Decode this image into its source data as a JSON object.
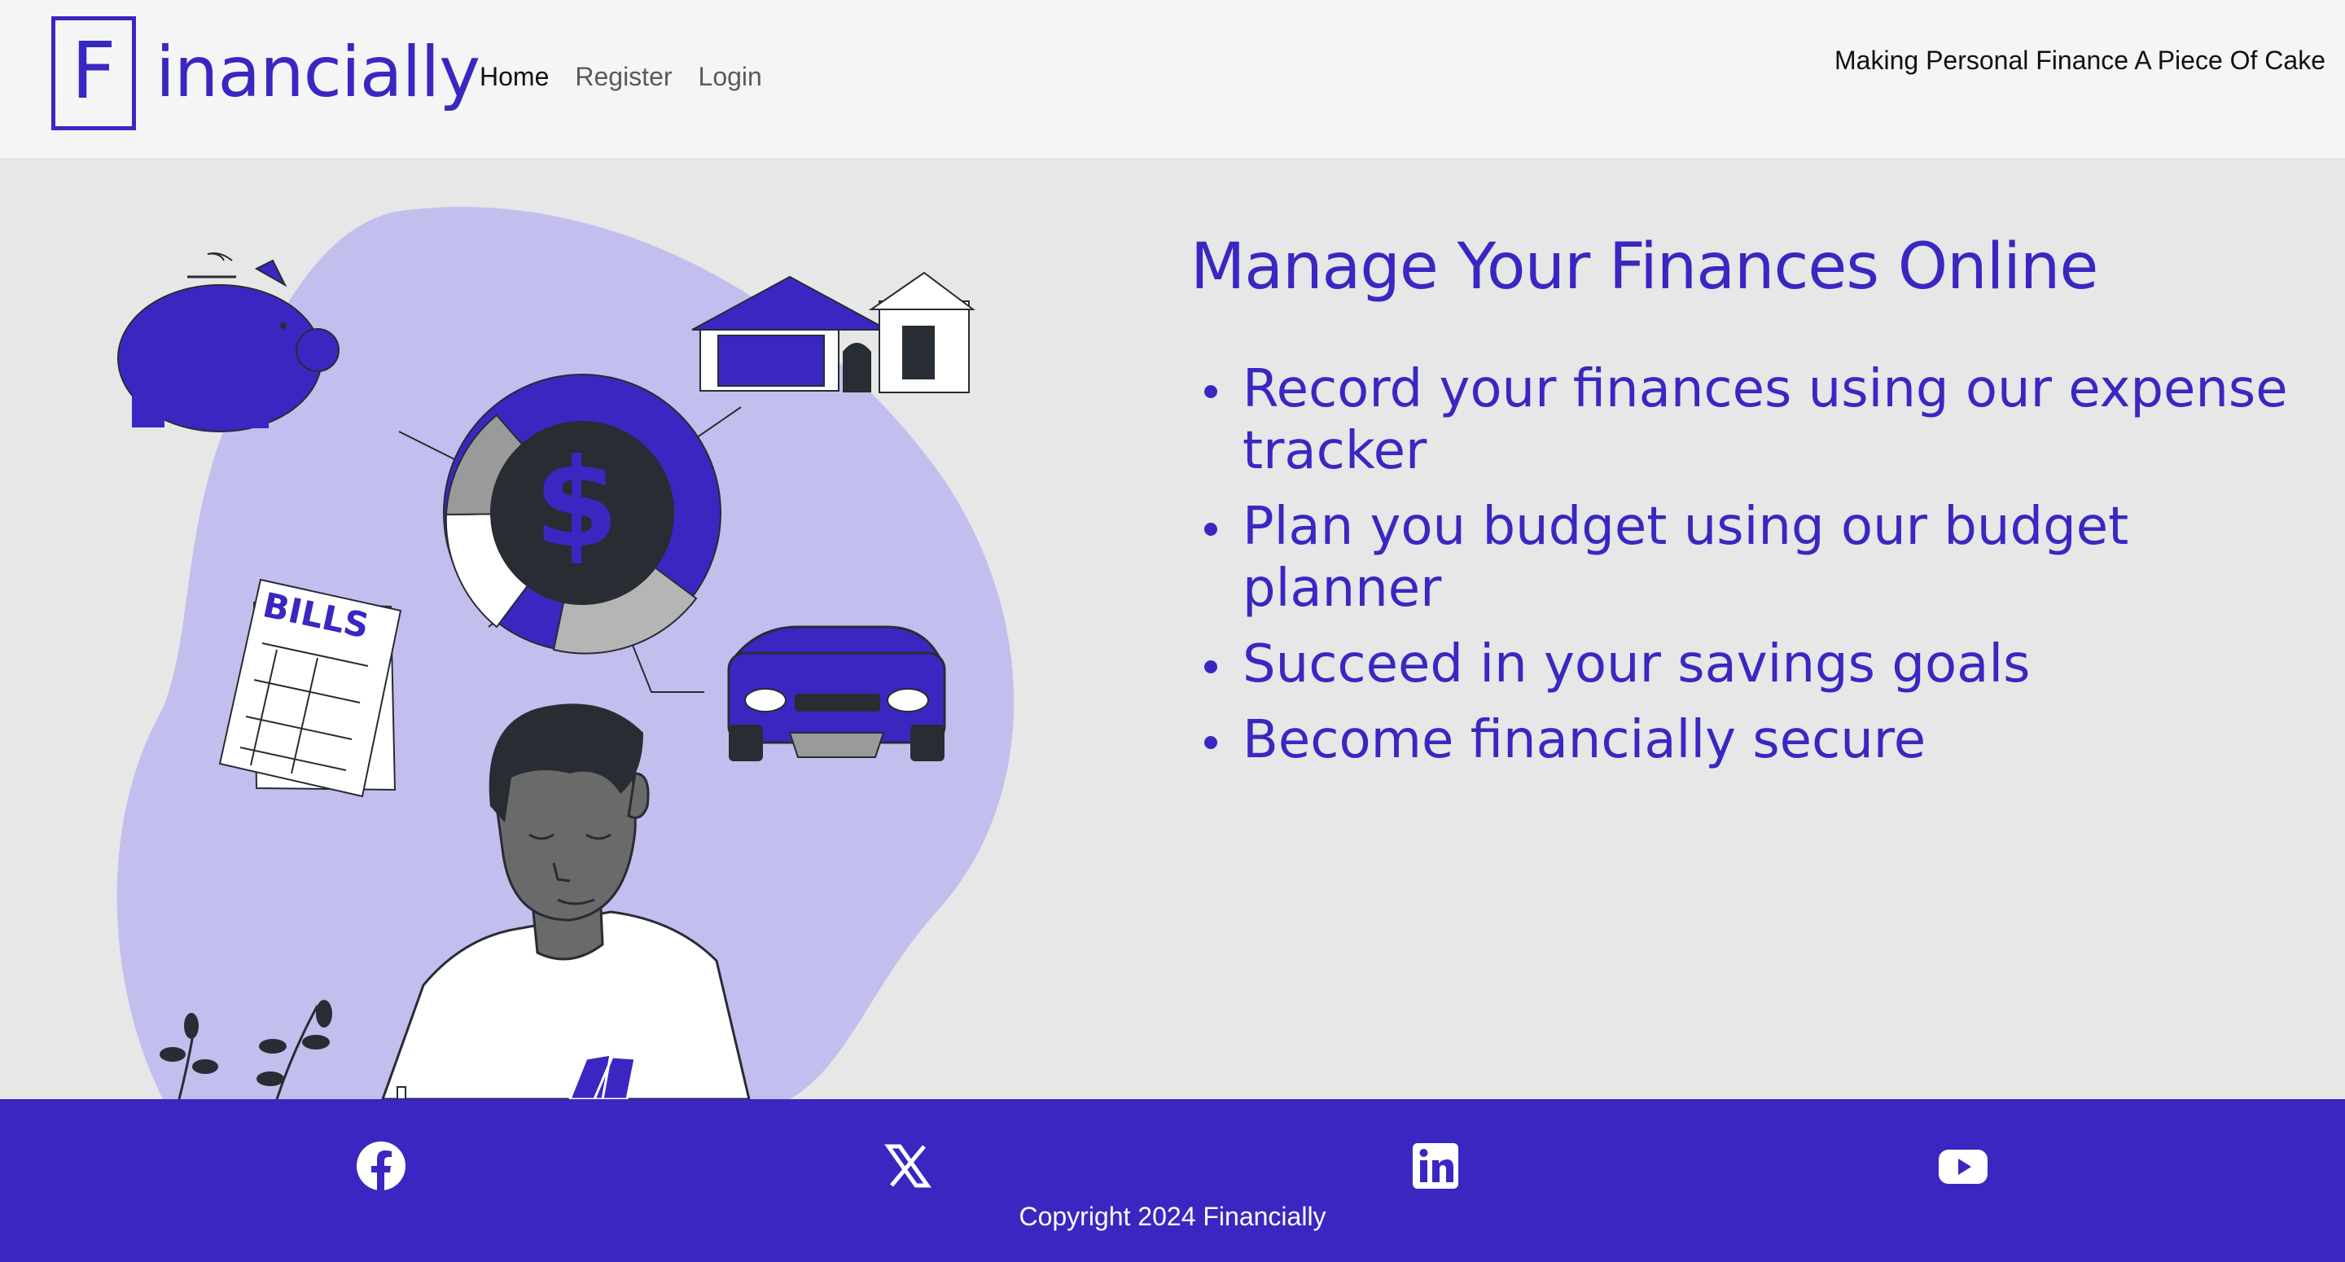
{
  "header": {
    "logo_letter": "F",
    "logo_rest": "inancially",
    "nav": [
      {
        "label": "Home",
        "active": true
      },
      {
        "label": "Register",
        "active": false
      },
      {
        "label": "Login",
        "active": false
      }
    ],
    "tagline": "Making Personal Finance A Piece Of Cake"
  },
  "hero": {
    "illustration": {
      "bills_label": "BILLS",
      "dollar_symbol": "$"
    },
    "headline": "Manage Your Finances Online",
    "features": [
      "Record your finances using our expense tracker",
      "Plan you budget using our budget planner",
      "Succeed in your savings goals",
      "Become financially secure"
    ]
  },
  "footer": {
    "social": [
      "facebook-icon",
      "x-icon",
      "linkedin-icon",
      "youtube-icon"
    ],
    "copyright": "Copyright 2024 Financially"
  },
  "colors": {
    "brand": "#3a27c2",
    "header_bg": "#f5f5f5",
    "page_bg": "#e6e7e6",
    "blob": "#c2bfee",
    "dark": "#282c33"
  }
}
